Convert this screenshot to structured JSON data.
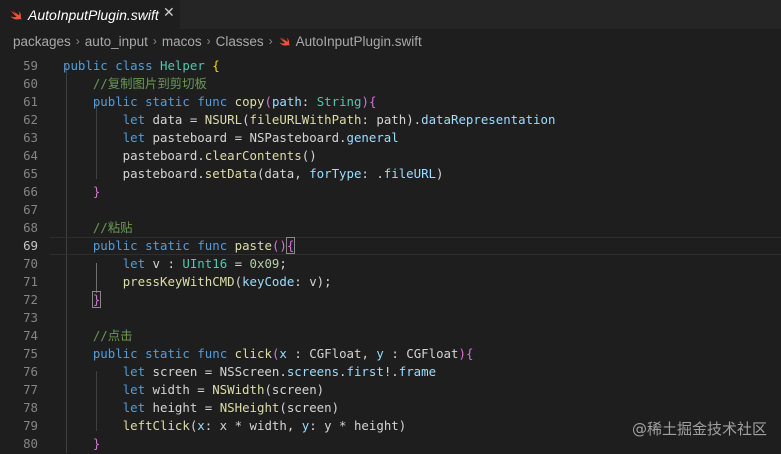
{
  "tab": {
    "filename": "AutoInputPlugin.swift",
    "close_glyph": "✕",
    "icon": "swift-icon"
  },
  "breadcrumb": [
    "packages",
    "auto_input",
    "macos",
    "Classes",
    "AutoInputPlugin.swift"
  ],
  "breadcrumb_separator": "›",
  "editor": {
    "active_line": "69",
    "lines": [
      {
        "n": "59",
        "t": [
          [
            "kw",
            "public"
          ],
          [
            "",
            ""
          ],
          [
            "",
            " "
          ],
          [
            "kw",
            "class"
          ],
          [
            "",
            " "
          ],
          [
            "ty",
            "Helper"
          ],
          [
            "",
            " "
          ],
          [
            "b2",
            "{"
          ]
        ]
      },
      {
        "n": "60",
        "t": [
          [
            "",
            "    "
          ],
          [
            "cm",
            "//复制图片到剪切板"
          ]
        ]
      },
      {
        "n": "61",
        "t": [
          [
            "",
            "    "
          ],
          [
            "kw",
            "public"
          ],
          [
            "",
            " "
          ],
          [
            "kw",
            "static"
          ],
          [
            "",
            " "
          ],
          [
            "kw",
            "func"
          ],
          [
            "",
            " "
          ],
          [
            "fn",
            "copy"
          ],
          [
            "b1",
            "("
          ],
          [
            "pr",
            "path"
          ],
          [
            "",
            ": "
          ],
          [
            "ty",
            "String"
          ],
          [
            "b1",
            ")"
          ],
          [
            "b1",
            "{"
          ]
        ]
      },
      {
        "n": "62",
        "t": [
          [
            "",
            "        "
          ],
          [
            "kw",
            "let"
          ],
          [
            "",
            " data = "
          ],
          [
            "fn",
            "NSURL"
          ],
          [
            "",
            "("
          ],
          [
            "fn",
            "fileURLWithPath"
          ],
          [
            "",
            ": path)."
          ],
          [
            "pr",
            "dataRepresentation"
          ]
        ]
      },
      {
        "n": "63",
        "t": [
          [
            "",
            "        "
          ],
          [
            "kw",
            "let"
          ],
          [
            "",
            " pasteboard = NSPasteboard."
          ],
          [
            "pr",
            "general"
          ]
        ]
      },
      {
        "n": "64",
        "t": [
          [
            "",
            "        pasteboard."
          ],
          [
            "fn",
            "clearContents"
          ],
          [
            "",
            "()"
          ]
        ]
      },
      {
        "n": "65",
        "t": [
          [
            "",
            "        pasteboard."
          ],
          [
            "fn",
            "setData"
          ],
          [
            "",
            "(data, "
          ],
          [
            "pr",
            "forType"
          ],
          [
            "",
            ": ."
          ],
          [
            "pr",
            "fileURL"
          ],
          [
            "",
            ")"
          ]
        ]
      },
      {
        "n": "66",
        "t": [
          [
            "",
            "    "
          ],
          [
            "b1",
            "}"
          ]
        ]
      },
      {
        "n": "67",
        "t": []
      },
      {
        "n": "68",
        "t": [
          [
            "",
            "    "
          ],
          [
            "cm",
            "//粘贴"
          ]
        ]
      },
      {
        "n": "69",
        "t": [
          [
            "",
            "    "
          ],
          [
            "kw",
            "public"
          ],
          [
            "",
            " "
          ],
          [
            "kw",
            "static"
          ],
          [
            "",
            " "
          ],
          [
            "kw",
            "func"
          ],
          [
            "",
            " "
          ],
          [
            "fn",
            "paste"
          ],
          [
            "b1",
            "()"
          ],
          [
            "b1 bm",
            "{"
          ]
        ]
      },
      {
        "n": "70",
        "t": [
          [
            "",
            "        "
          ],
          [
            "kw",
            "let"
          ],
          [
            "",
            " v : "
          ],
          [
            "ty",
            "UInt16"
          ],
          [
            "",
            " = "
          ],
          [
            "nm",
            "0x09"
          ],
          [
            "",
            ";"
          ]
        ]
      },
      {
        "n": "71",
        "t": [
          [
            "",
            "        "
          ],
          [
            "fn",
            "pressKeyWithCMD"
          ],
          [
            "",
            "("
          ],
          [
            "pr",
            "keyCode"
          ],
          [
            "",
            ": v);"
          ]
        ]
      },
      {
        "n": "72",
        "t": [
          [
            "",
            "    "
          ],
          [
            "b1 bm",
            "}"
          ]
        ]
      },
      {
        "n": "73",
        "t": []
      },
      {
        "n": "74",
        "t": [
          [
            "",
            "    "
          ],
          [
            "cm",
            "//点击"
          ]
        ]
      },
      {
        "n": "75",
        "t": [
          [
            "",
            "    "
          ],
          [
            "kw",
            "public"
          ],
          [
            "",
            " "
          ],
          [
            "kw",
            "static"
          ],
          [
            "",
            " "
          ],
          [
            "kw",
            "func"
          ],
          [
            "",
            " "
          ],
          [
            "fn",
            "click"
          ],
          [
            "b1",
            "("
          ],
          [
            "pr",
            "x"
          ],
          [
            "",
            " : CGFloat, "
          ],
          [
            "pr",
            "y"
          ],
          [
            "",
            " : CGFloat"
          ],
          [
            "b1",
            ")"
          ],
          [
            "b1",
            "{"
          ]
        ]
      },
      {
        "n": "76",
        "t": [
          [
            "",
            "        "
          ],
          [
            "kw",
            "let"
          ],
          [
            "",
            " screen = NSScreen."
          ],
          [
            "pr",
            "screens"
          ],
          [
            "",
            "."
          ],
          [
            "pr",
            "first"
          ],
          [
            "",
            "!."
          ],
          [
            "pr",
            "frame"
          ]
        ]
      },
      {
        "n": "77",
        "t": [
          [
            "",
            "        "
          ],
          [
            "kw",
            "let"
          ],
          [
            "",
            " width = "
          ],
          [
            "fn",
            "NSWidth"
          ],
          [
            "",
            "(screen)"
          ]
        ]
      },
      {
        "n": "78",
        "t": [
          [
            "",
            "        "
          ],
          [
            "kw",
            "let"
          ],
          [
            "",
            " height = "
          ],
          [
            "fn",
            "NSHeight"
          ],
          [
            "",
            "(screen)"
          ]
        ]
      },
      {
        "n": "79",
        "t": [
          [
            "",
            "        "
          ],
          [
            "fn",
            "leftClick"
          ],
          [
            "",
            "("
          ],
          [
            "pr",
            "x"
          ],
          [
            "",
            ": x * width, "
          ],
          [
            "pr",
            "y"
          ],
          [
            "",
            ": y * height)"
          ]
        ]
      },
      {
        "n": "80",
        "t": [
          [
            "",
            "    "
          ],
          [
            "b1",
            "}"
          ]
        ]
      }
    ]
  },
  "watermark": "@稀土掘金技术社区",
  "colors": {
    "background": "#1e1e1e",
    "keyword": "#569cd6",
    "type": "#4ec9b0",
    "function": "#dcdcaa",
    "property": "#9cdcfe",
    "comment": "#6a9955",
    "swift_icon": "#f05138"
  }
}
